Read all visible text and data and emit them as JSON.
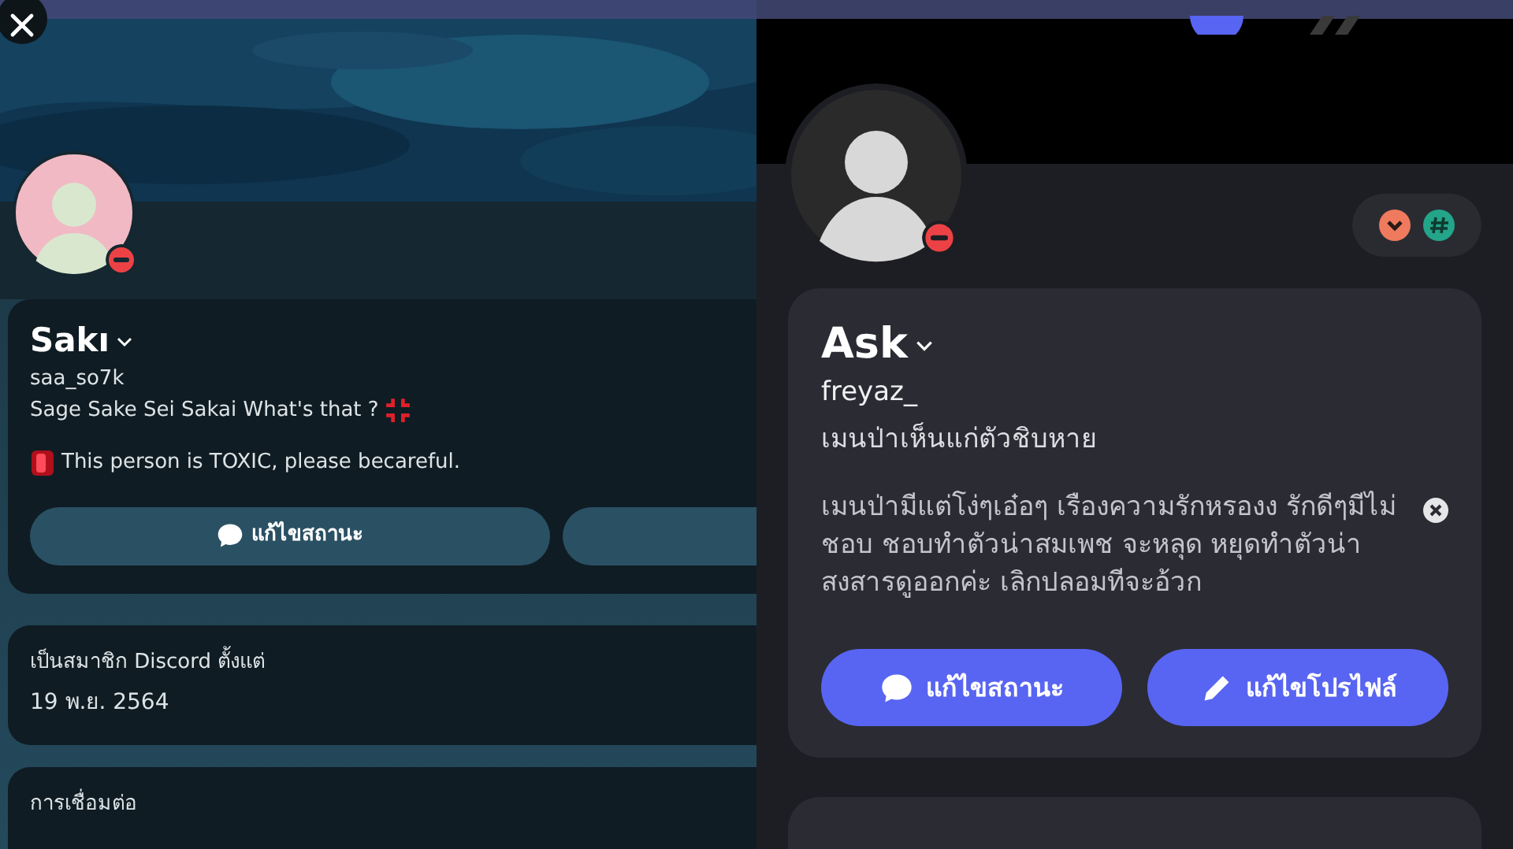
{
  "left_profile": {
    "do_not_disturb": true,
    "display_name": "Sakı",
    "username": "saa_so7k",
    "bio": "Sage Sake Sei Sakai What's that ?",
    "status_text": "This person is TOXIC, please becareful.",
    "buttons": [
      {
        "kind": "status",
        "label": "แก้ไขสถานะ"
      },
      {
        "kind": "blank"
      }
    ],
    "member_since": {
      "label": "เป็นสมาชิก Discord ตั้งแต่",
      "value": "19 พ.ย. 2564"
    },
    "connections": {
      "label": "การเชื่อมต่อ"
    }
  },
  "right_profile": {
    "do_not_disturb": true,
    "display_name": "Ask",
    "username": "freyaz_",
    "pronouns": "เมนป่าเห็นแก่ตัวชิบหาย",
    "custom_status": "เมนป่ามีแต่โง่ๆเอ๋อๆ เรืองความรักหรองง รักดีๆมีไม่ชอบ ชอบทำตัวน่าสมเพช จะหลุด หยุดทำตัวน่าสงสารดูออกค่ะ เลิกปลอมทีจะอ้วก",
    "badges": [
      {
        "kind": "chevron",
        "color": "#f07a5e"
      },
      {
        "kind": "hashtag",
        "color": "#23a58a"
      }
    ],
    "buttons": [
      {
        "kind": "status",
        "label": "แก้ไขสถานะ"
      },
      {
        "kind": "edit",
        "label": "แก้ไขโปรไฟล์"
      }
    ]
  }
}
